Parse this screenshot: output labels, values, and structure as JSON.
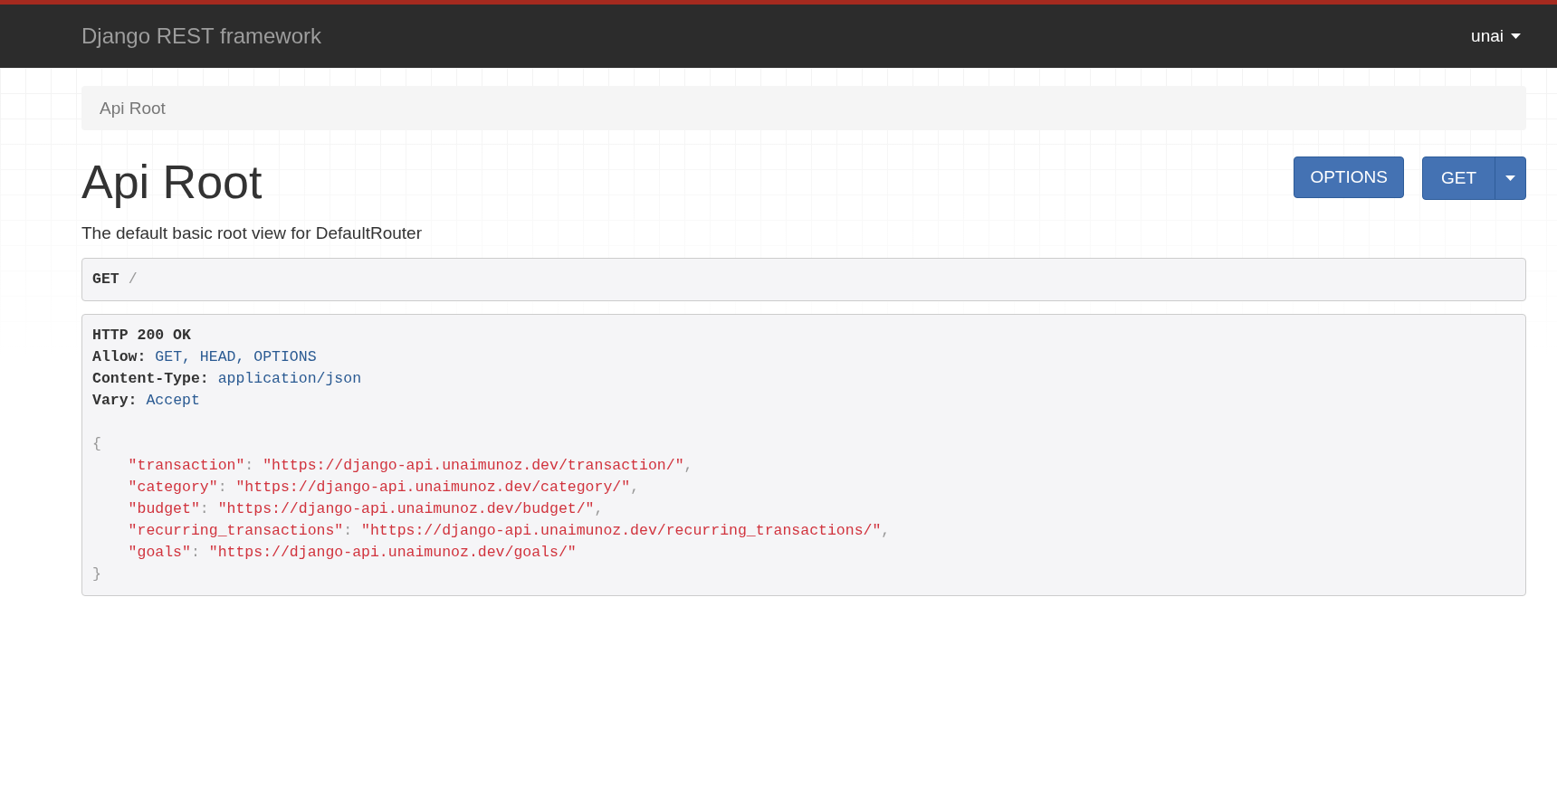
{
  "navbar": {
    "brand": "Django REST framework",
    "user": "unai"
  },
  "breadcrumb": [
    {
      "label": "Api Root",
      "selected": true
    }
  ],
  "title": "Api Root",
  "buttons": [
    {
      "label": "OPTIONS",
      "kind": "plain"
    },
    {
      "label": "GET",
      "kind": "split"
    }
  ],
  "description": "The default basic root view for DefaultRouter",
  "request": {
    "method": "GET",
    "path": "/"
  },
  "response": {
    "status": "HTTP 200 OK",
    "headers": [
      {
        "name": "Allow:",
        "value": "GET, HEAD, OPTIONS"
      },
      {
        "name": "Content-Type:",
        "value": "application/json"
      },
      {
        "name": "Vary:",
        "value": "Accept"
      }
    ],
    "open": "{",
    "entries": [
      {
        "key": "\"transaction\"",
        "colon": ":",
        "value": "\"https://django-api.unaimunoz.dev/transaction/\"",
        "comma": ","
      },
      {
        "key": "\"category\"",
        "colon": ":",
        "value": "\"https://django-api.unaimunoz.dev/category/\"",
        "comma": ","
      },
      {
        "key": "\"budget\"",
        "colon": ":",
        "value": "\"https://django-api.unaimunoz.dev/budget/\"",
        "comma": ","
      },
      {
        "key": "\"recurring_transactions\"",
        "colon": ":",
        "value": "\"https://django-api.unaimunoz.dev/recurring_transactions/\"",
        "comma": ","
      },
      {
        "key": "\"goals\"",
        "colon": ":",
        "value": "\"https://django-api.unaimunoz.dev/goals/\""
      }
    ],
    "close": "}"
  }
}
